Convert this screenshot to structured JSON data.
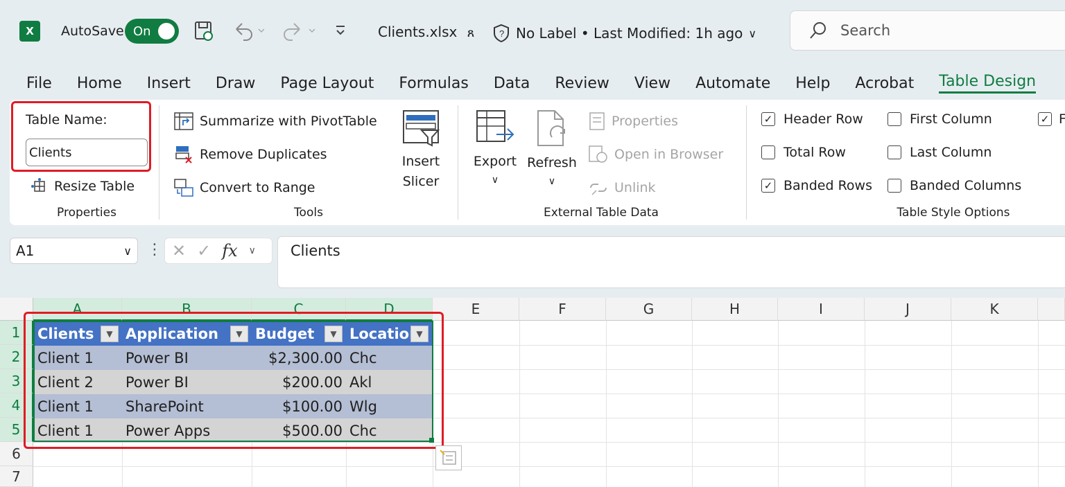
{
  "titlebar": {
    "app_logo": "X",
    "autosave_label": "AutoSave",
    "autosave_state": "On",
    "filename": "Clients.xlsx",
    "label_status": "No Label • Last Modified: 1h ago",
    "search_placeholder": "Search"
  },
  "tabs": [
    "File",
    "Home",
    "Insert",
    "Draw",
    "Page Layout",
    "Formulas",
    "Data",
    "Review",
    "View",
    "Automate",
    "Help",
    "Acrobat",
    "Table Design"
  ],
  "active_tab": "Table Design",
  "ribbon": {
    "properties": {
      "table_name_label": "Table Name:",
      "table_name_value": "Clients",
      "resize_table": "Resize Table",
      "group_label": "Properties"
    },
    "tools": {
      "summarize": "Summarize with PivotTable",
      "remove_duplicates": "Remove Duplicates",
      "convert_to_range": "Convert to Range",
      "insert_slicer_line1": "Insert",
      "insert_slicer_line2": "Slicer",
      "group_label": "Tools"
    },
    "external": {
      "export": "Export",
      "refresh": "Refresh",
      "properties": "Properties",
      "open_in_browser": "Open in Browser",
      "unlink": "Unlink",
      "group_label": "External Table Data"
    },
    "style_options": {
      "header_row": "Header Row",
      "total_row": "Total Row",
      "banded_rows": "Banded Rows",
      "first_column": "First Column",
      "last_column": "Last Column",
      "banded_columns": "Banded Columns",
      "header_row_checked": true,
      "total_row_checked": false,
      "banded_rows_checked": true,
      "first_column_checked": false,
      "last_column_checked": false,
      "banded_columns_checked": false,
      "cut_off": "F",
      "group_label": "Table Style Options"
    }
  },
  "formula_bar": {
    "name_box": "A1",
    "fx": "fx",
    "content": "Clients"
  },
  "sheet": {
    "columns": [
      "A",
      "B",
      "C",
      "D",
      "E",
      "F",
      "G",
      "H",
      "I",
      "J",
      "K"
    ],
    "rows": [
      "1",
      "2",
      "3",
      "4",
      "5",
      "6",
      "7"
    ],
    "table_headers": [
      "Clients",
      "Application",
      "Budget",
      "Location"
    ],
    "table_rows": [
      [
        "Client 1",
        "Power BI",
        "$2,300.00",
        "Chc"
      ],
      [
        "Client 2",
        "Power BI",
        "$200.00",
        "Akl"
      ],
      [
        "Client 1",
        "SharePoint",
        "$100.00",
        "Wlg"
      ],
      [
        "Client 1",
        "Power Apps",
        "$500.00",
        "Chc"
      ]
    ]
  },
  "colors": {
    "accent": "#107c41",
    "table_header": "#4472c4",
    "band_dark": "#b4bed4",
    "band_light": "#d4d4d4",
    "highlight": "#e01b24"
  }
}
